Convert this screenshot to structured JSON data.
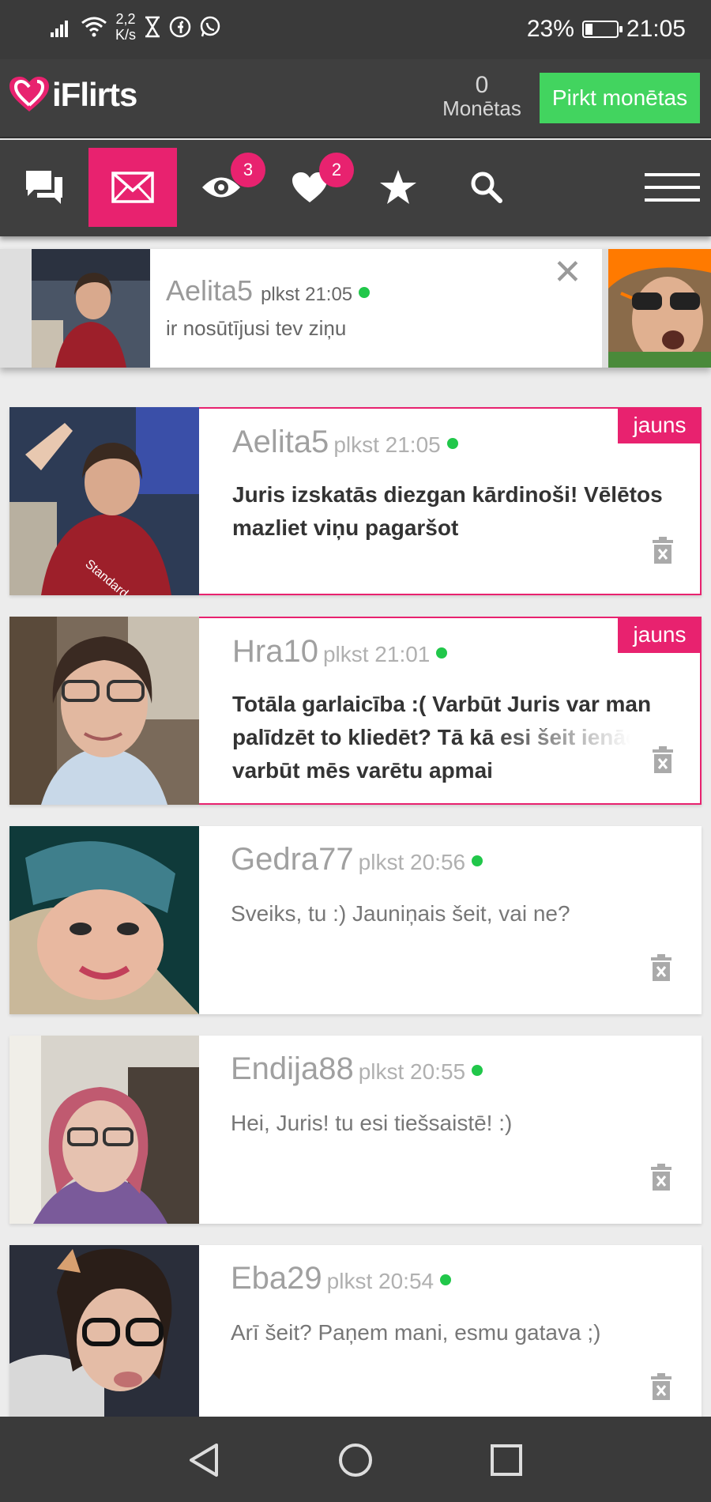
{
  "status_bar": {
    "speed_value": "2,2",
    "speed_unit": "K/s",
    "battery_text": "23%",
    "battery_level": 0.23,
    "time": "21:05"
  },
  "header": {
    "brand": "iFlirts",
    "coins_count": "0",
    "coins_label": "Monētas",
    "buy_button": "Pirkt monētas"
  },
  "nav": {
    "views_badge": "3",
    "likes_badge": "2"
  },
  "notification": {
    "name": "Aelita5",
    "time": "plkst 21:05",
    "message": "ir nosūtījusi tev ziņu"
  },
  "messages": [
    {
      "name": "Aelita5",
      "time": "plkst 21:05",
      "text": "Juris izskatās diezgan kārdinoši! Vēlētos mazliet viņu pagaršot",
      "badge": "jauns"
    },
    {
      "name": "Hra10",
      "time": "plkst 21:01",
      "text": "Totāla garlaicība :( Varbūt Juris var man palīdzēt to kliedēt? Tā kā esi šeit ienācis, varbūt mēs varētu apmai",
      "badge": "jauns"
    },
    {
      "name": "Gedra77",
      "time": "plkst 20:56",
      "text": "Sveiks, tu :) Jauniņais šeit, vai ne?"
    },
    {
      "name": "Endija88",
      "time": "plkst 20:55",
      "text": "Hei, Juris! tu esi tiešsaistē! :)"
    },
    {
      "name": "Eba29",
      "time": "plkst 20:54",
      "text": "Arī šeit? Paņem mani, esmu gatava ;)"
    }
  ],
  "colors": {
    "accent": "#e8226f",
    "buy_green": "#42d45f",
    "online_dot": "#21c74a",
    "header_bg": "#3f3f3f"
  }
}
